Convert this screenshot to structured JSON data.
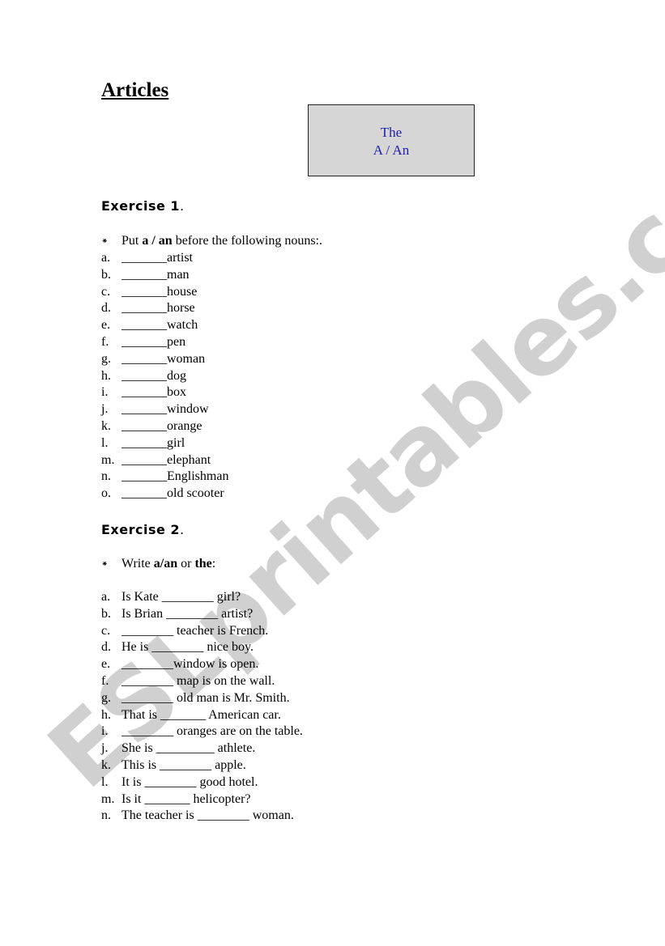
{
  "title": "Articles",
  "box": {
    "line1": "The",
    "line2": "A / An"
  },
  "exercise1": {
    "heading": "Exercise 1",
    "heading_dot": ".",
    "bullet": "⁕",
    "instruction_parts": [
      "Put ",
      "a / an",
      " before the following nouns:."
    ],
    "items": [
      {
        "label": "a.",
        "text": "_______artist"
      },
      {
        "label": "b.",
        "text": "_______man"
      },
      {
        "label": "c.",
        "text": "_______house"
      },
      {
        "label": "d.",
        "text": "_______horse"
      },
      {
        "label": "e.",
        "text": "_______watch"
      },
      {
        "label": "f.",
        "text": "_______pen"
      },
      {
        "label": "g.",
        "text": "_______woman"
      },
      {
        "label": "h.",
        "text": "_______dog"
      },
      {
        "label": "i.",
        "text": "_______box"
      },
      {
        "label": "j.",
        "text": "_______window"
      },
      {
        "label": "k.",
        "text": "_______orange"
      },
      {
        "label": "l.",
        "text": "_______girl"
      },
      {
        "label": "m.",
        "text": "_______elephant"
      },
      {
        "label": "n.",
        "text": "_______Englishman"
      },
      {
        "label": "o.",
        "text": "_______old scooter"
      }
    ]
  },
  "exercise2": {
    "heading": "Exercise 2",
    "heading_dot": ".",
    "bullet": "⁕",
    "instruction_parts": [
      "Write ",
      "a/an",
      " or ",
      "the",
      ":"
    ],
    "items": [
      {
        "label": "a.",
        "text": "Is Kate ________ girl?"
      },
      {
        "label": "b.",
        "text": "Is Brian ________  artist?"
      },
      {
        "label": "c.",
        "text": "________ teacher is French."
      },
      {
        "label": "d.",
        "text": "He is ________ nice boy."
      },
      {
        "label": "e.",
        "text": "________window is open."
      },
      {
        "label": "f.",
        "text": "________ map is on the wall."
      },
      {
        "label": "g.",
        "text": "________ old man is Mr. Smith."
      },
      {
        "label": "h.",
        "text": "That is _______ American car."
      },
      {
        "label": "i.",
        "text": "________ oranges are on the table."
      },
      {
        "label": "j.",
        "text": "She is _________ athlete."
      },
      {
        "label": "k.",
        "text": "This is ________ apple."
      },
      {
        "label": "l.",
        "text": "It is ________ good hotel."
      },
      {
        "label": "m.",
        "text": "Is it _______ helicopter?"
      },
      {
        "label": "n.",
        "text": "The teacher is ________ woman."
      }
    ]
  },
  "watermark": "ESLprintables.com"
}
